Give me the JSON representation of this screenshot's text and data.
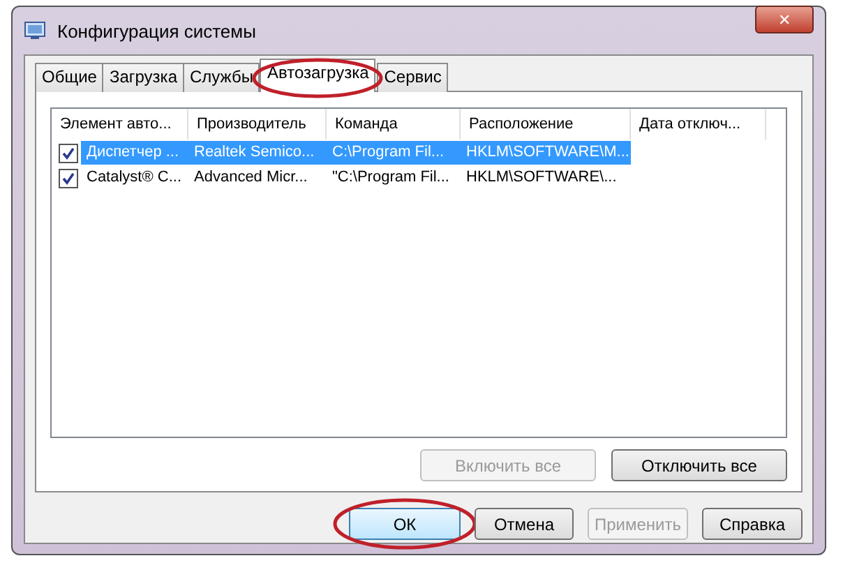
{
  "window": {
    "title": "Конфигурация системы",
    "close": "✕"
  },
  "tabs": [
    {
      "label": "Общие",
      "selected": false,
      "circled": false
    },
    {
      "label": "Загрузка",
      "selected": false,
      "circled": false
    },
    {
      "label": "Службы",
      "selected": false,
      "circled": false
    },
    {
      "label": "Автозагрузка",
      "selected": true,
      "circled": true
    },
    {
      "label": "Сервис",
      "selected": false,
      "circled": false
    }
  ],
  "table": {
    "columns": [
      "Элемент авто...",
      "Производитель",
      "Команда",
      "Расположение",
      "Дата отключ..."
    ],
    "rows": [
      {
        "checked": true,
        "selected": true,
        "cells": [
          "Диспетчер ...",
          "Realtek Semico...",
          "C:\\Program Fil...",
          "HKLM\\SOFTWARE\\M..."
        ]
      },
      {
        "checked": true,
        "selected": false,
        "cells": [
          "Catalyst® C...",
          "Advanced Micr...",
          "\"C:\\Program Fil...",
          "HKLM\\SOFTWARE\\..."
        ]
      }
    ]
  },
  "list_buttons": [
    {
      "label": "Включить все",
      "disabled": true
    },
    {
      "label": "Отключить все",
      "disabled": false
    }
  ],
  "buttons": [
    {
      "label": "ОК",
      "disabled": false,
      "circled": true
    },
    {
      "label": "Отмена",
      "disabled": false,
      "circled": false
    },
    {
      "label": "Применить",
      "disabled": true,
      "circled": false
    },
    {
      "label": "Справка",
      "disabled": false,
      "circled": false
    }
  ]
}
